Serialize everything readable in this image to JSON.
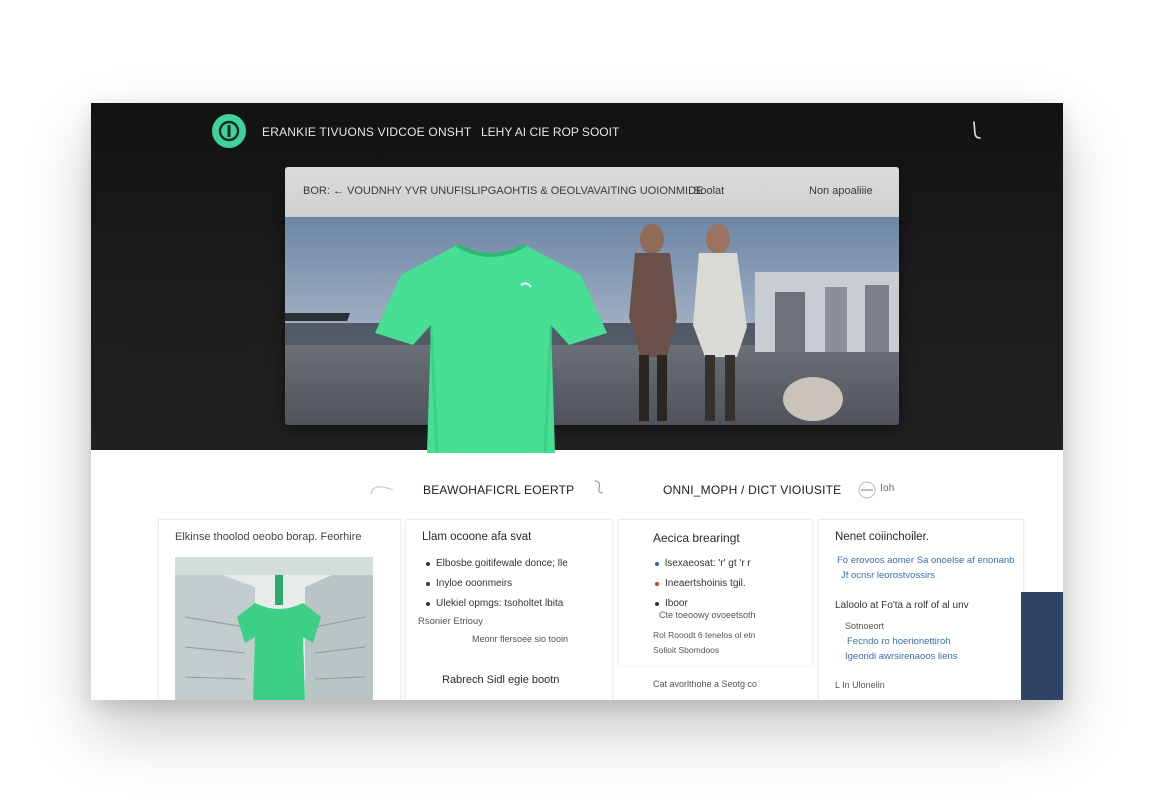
{
  "header": {
    "title": "ERANKIE TIVUONS VIDCOE ONSHT",
    "links": "LEHY AI CIE ROP  SOOIT"
  },
  "panel": {
    "bar_left": "BOR: ← VOUDNHY YVR UNUFISLIPGAOHTIS & OEOLVAVAITING UOIONMIDE",
    "bar_mid": "Soolat",
    "bar_right": "Non apoaliiie"
  },
  "sections": {
    "left_label": "BEAWOHAFICRL EOERTP",
    "right_label": "ONNI_MOPH / DICT VIOIUSITE",
    "side_label": "Ioh"
  },
  "cards": [
    {
      "title": "Elkinse thoolod oeobo borap. Feorhire"
    },
    {
      "title": "Llam ocoone afa svat",
      "items": [
        "Elbosbe goitifewale donce; lle",
        "Inyloe ooonmeirs",
        "Ulekiel opmgs: tsoholtet lbita"
      ],
      "line2": "Rsonier Etriouy",
      "line3": "Meonr flersoee sio tooin",
      "footer": "Rabrech Sidl egie bootn"
    },
    {
      "title": "Aecica brearingt",
      "items": [
        "lsexaeosat: 'r' gt 'r r",
        "Ineaertshoinis tgil.",
        "Iboor"
      ],
      "line_a": "Cte toeoowy  ovoeetsoth",
      "line_b": "Rol Rooodt 6 tenelos ol etn",
      "line_c": "Solloit Sbomdoos",
      "footer": "Cat avorlthohe a Seotg co"
    },
    {
      "title": "Nenet coiinchoiler.",
      "link1": "Fo erovoos aomer Sa onoelse af enonanb",
      "link2": "Jf ocnsr leorostvossirs",
      "line_a": "Laloolo at  Fo'ta a rolf of al unv",
      "line_b": "Sotnoeort",
      "link3": "Fecndo ro hoerionettiroh",
      "link4": "Igeondi awrsirenaoos liens",
      "footer": "L In Ulonelin"
    }
  ],
  "colors": {
    "accent_green": "#3fd39b",
    "hero_dark": "#161616",
    "link_blue": "#3b6fb7",
    "navy": "#2f4366"
  }
}
